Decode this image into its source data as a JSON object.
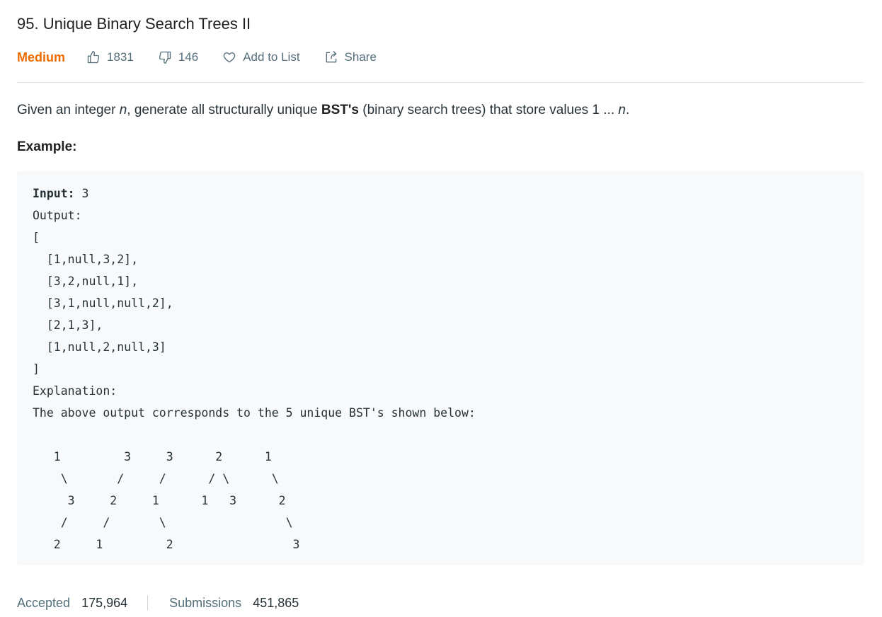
{
  "problem": {
    "title": "95. Unique Binary Search Trees II",
    "difficulty": "Medium",
    "likes": "1831",
    "dislikes": "146",
    "add_to_list_label": "Add to List",
    "share_label": "Share",
    "colors": {
      "difficulty": "#ef6c00",
      "text": "#263238",
      "muted": "#546e7a",
      "code_bg": "#f7f9fa"
    }
  },
  "description": {
    "part1": "Given an integer ",
    "var_n": "n",
    "part2": ", generate all structurally unique ",
    "bold": "BST's",
    "part3": " (binary search trees) that store values 1 ... ",
    "var_n_end": "n",
    "part4": "."
  },
  "example": {
    "label": "Example:",
    "input_key": "Input:",
    "input_value": " 3",
    "output_key": "Output:",
    "output_lines": [
      "[",
      "  [1,null,3,2],",
      "  [3,2,null,1],",
      "  [3,1,null,null,2],",
      "  [2,1,3],",
      "  [1,null,2,null,3]",
      "]"
    ],
    "explanation_key": "Explanation:",
    "explanation_text": "The above output corresponds to the 5 unique BST's shown below:",
    "tree_lines": [
      "   1         3     3      2      1",
      "    \\       /     /      / \\      \\",
      "     3     2     1      1   3      2",
      "    /     /       \\                 \\",
      "   2     1         2                 3"
    ]
  },
  "stats": {
    "accepted_label": "Accepted",
    "accepted_value": "175,964",
    "submissions_label": "Submissions",
    "submissions_value": "451,865"
  },
  "icons": {
    "like": "thumbs-up-icon",
    "dislike": "thumbs-down-icon",
    "add_to_list": "heart-icon",
    "share": "share-icon"
  }
}
